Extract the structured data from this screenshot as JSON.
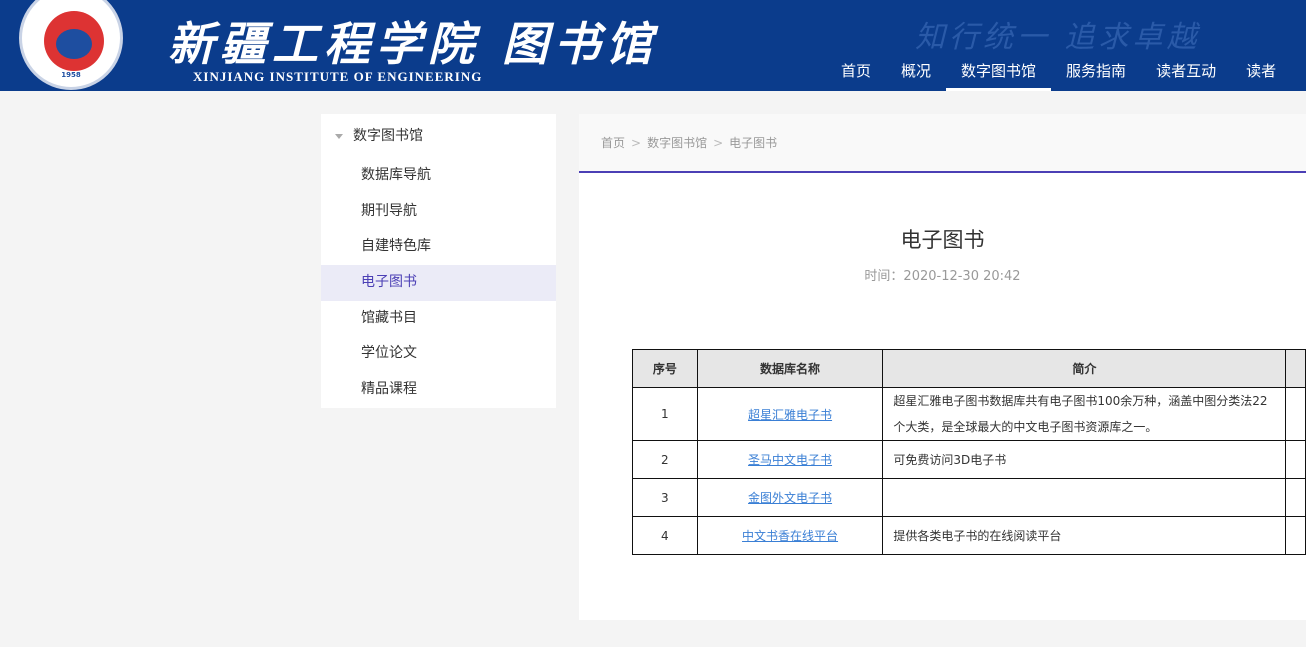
{
  "header": {
    "site_name_cn": "新疆工程学院 图书馆",
    "site_name_en": "XINJIANG INSTITUTE OF ENGINEERING",
    "motto": "知行统一 追求卓越",
    "logo_year": "1958",
    "nav": [
      "首页",
      "概况",
      "数字图书馆",
      "服务指南",
      "读者互动",
      "读者"
    ],
    "nav_active": 2
  },
  "sidebar": {
    "title": "数字图书馆",
    "items": [
      "数据库导航",
      "期刊导航",
      "自建特色库",
      "电子图书",
      "馆藏书目",
      "学位论文",
      "精品课程"
    ],
    "active": 3
  },
  "breadcrumb": [
    "首页",
    "数字图书馆",
    "电子图书"
  ],
  "article": {
    "title": "电子图书",
    "time": "时间：2020-12-30 20:42"
  },
  "table": {
    "headers": [
      "序号",
      "数据库名称",
      "简介"
    ],
    "rows": [
      {
        "no": "1",
        "name": "超星汇雅电子书",
        "desc": "超星汇雅电子图书数据库共有电子图书100余万种，涵盖中图分类法22个大类，是全球最大的中文电子图书资源库之一。"
      },
      {
        "no": "2",
        "name": "圣马中文电子书",
        "desc": "可免费访问3D电子书"
      },
      {
        "no": "3",
        "name": "金图外文电子书",
        "desc": ""
      },
      {
        "no": "4",
        "name": "中文书香在线平台",
        "desc": "提供各类电子书的在线阅读平台"
      }
    ]
  }
}
